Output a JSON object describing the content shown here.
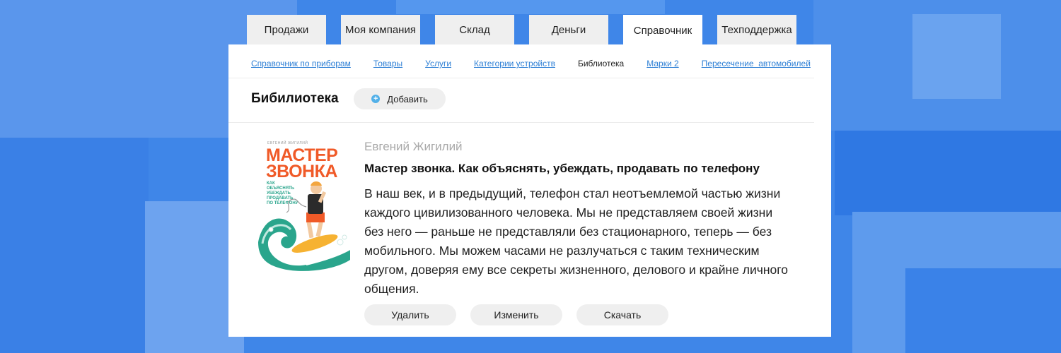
{
  "tabs": [
    {
      "label": "Продажи"
    },
    {
      "label": "Моя компания"
    },
    {
      "label": "Склад"
    },
    {
      "label": "Деньги"
    },
    {
      "label": "Справочник"
    },
    {
      "label": "Техподдержка"
    }
  ],
  "subnav": [
    {
      "label": "Справочник по приборам"
    },
    {
      "label": "Товары"
    },
    {
      "label": "Услуги"
    },
    {
      "label": "Категории устройств"
    },
    {
      "label": "Библиотека"
    },
    {
      "label": "Марки 2"
    },
    {
      "label": "Пересечение  автомобилей"
    }
  ],
  "page": {
    "title": "Бибилиотека",
    "add_label": "Добавить",
    "add_icon": "plus-circle-icon"
  },
  "book": {
    "author": "Евгений Жигилий",
    "title": "Мастер звонка. Как объяснять, убеждать, продавать по телефону",
    "description": "В наш век, и в предыдущий, телефон стал неотъемлемой частью жизни каждого цивилизованного человека. Мы не представляем своей жизни без него — раньше не представляли без стационарного, теперь — без мобильного. Мы можем часами не разлучаться с таким техническим другом, доверяя ему все секреты жизненного, делового и крайне личного общения.",
    "cover": {
      "author": "ЕВГЕНИЙ ЖИГИЛИЙ",
      "title_line1": "МАСТЕР",
      "title_line2": "ЗВОНКА",
      "subtitle": "КАК ОБЪЯСНЯТЬ УБЕЖДАТЬ ПРОДАВАТЬ ПО ТЕЛЕФОНУ"
    }
  },
  "actions": {
    "delete_label": "Удалить",
    "edit_label": "Изменить",
    "download_label": "Скачать"
  },
  "colors": {
    "background": "#3f86e8",
    "link": "#2d7fd5",
    "cover_title": "#f05a28",
    "wave": "#2aa58c",
    "icon": "#52b0e8"
  }
}
